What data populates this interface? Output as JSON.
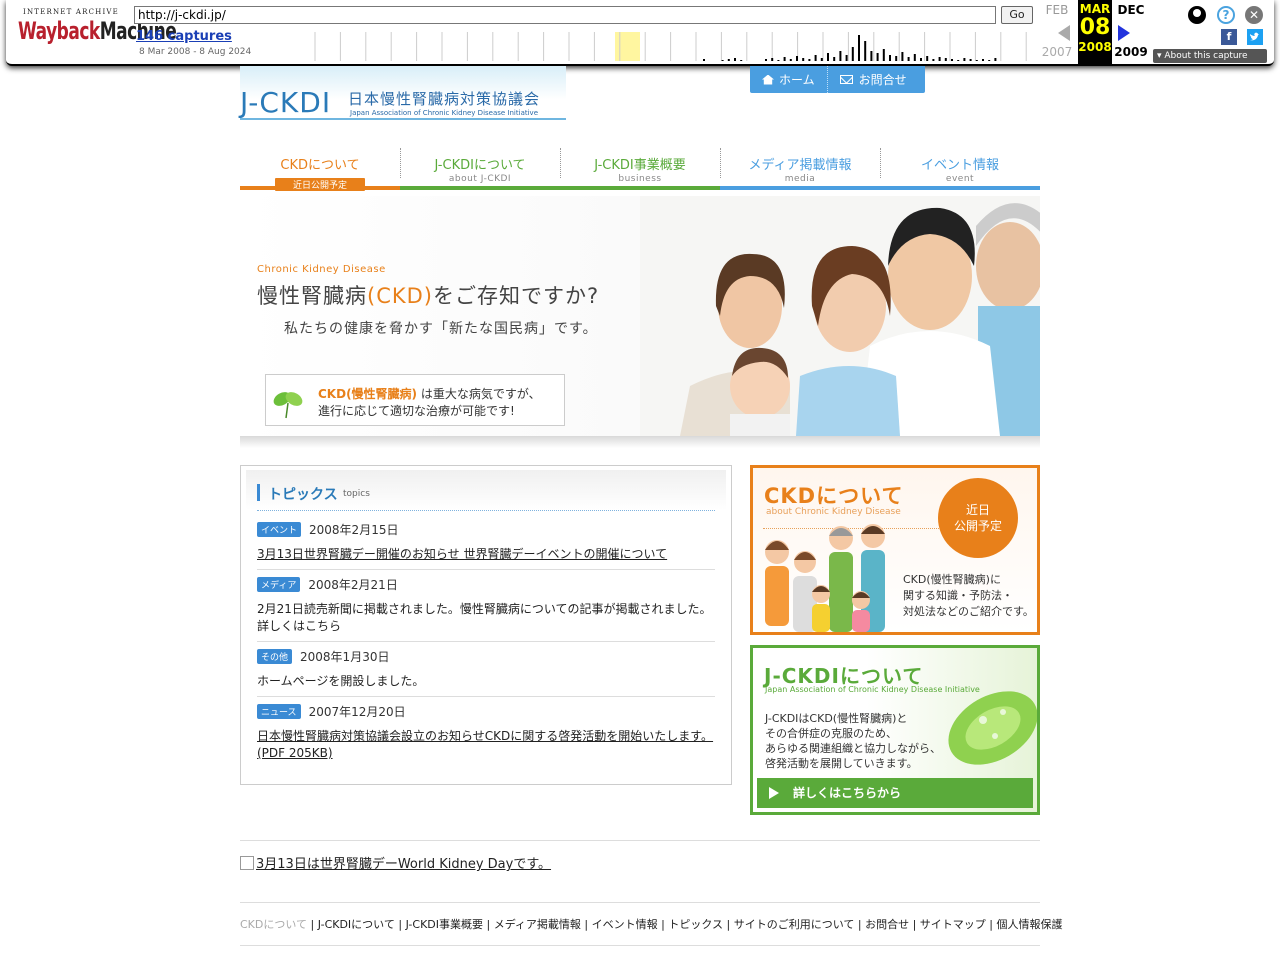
{
  "wayback": {
    "logo_top": "INTERNET ARCHIVE",
    "logo_main_red": "Wayback",
    "logo_main_dark": "Machine",
    "url": "http://j-ckdi.jp/",
    "go_label": "Go",
    "captures": "146 captures",
    "range": "8 Mar 2008 - 8 Aug 2024",
    "prev_month": "FEB",
    "cur_month": "MAR",
    "next_month": "DEC",
    "day": "08",
    "prev_year": "2007",
    "cur_year": "2008",
    "next_year": "2009",
    "about": "About this capture",
    "fb": "f",
    "close": "✕",
    "help": "?"
  },
  "site": {
    "logo_big": "J-CKDI",
    "logo_jp": "日本慢性腎臓病対策協議会",
    "logo_en": "Japan Association of Chronic Kidney Disease Initiative",
    "top_nav": [
      "ホーム",
      "お問合せ"
    ],
    "nav": [
      {
        "title": "CKDについて",
        "sub": "近日公開予定",
        "color": "#e8801a",
        "badge": true
      },
      {
        "title": "J-CKDIについて",
        "sub": "about J-CKDI",
        "color": "#5aaa3a"
      },
      {
        "title": "J-CKDI事業概要",
        "sub": "business",
        "color": "#5aaa3a"
      },
      {
        "title": "メディア掲載情報",
        "sub": "media",
        "color": "#4a9ee0"
      },
      {
        "title": "イベント情報",
        "sub": "event",
        "color": "#4a9ee0"
      }
    ],
    "hero": {
      "sub": "Chronic Kidney Disease",
      "head_pre": "慢性腎臓病",
      "head_ckd": "(CKD)",
      "head_post": "をご存知ですか?",
      "tag": "私たちの健康を脅かす「新たな国民病」です。",
      "note_ckd": "CKD(慢性腎臓病)",
      "note_l1_rest": "は重大な病気ですが、",
      "note_l2": "進行に応じて適切な治療が可能です!"
    },
    "topics": {
      "title": "トピックス",
      "en": "topics",
      "items": [
        {
          "cat": "イベント",
          "date": "2008年2月15日",
          "text": "3月13日世界腎臓デー開催のお知らせ 世界腎臓デーイベントの開催について",
          "link": true
        },
        {
          "cat": "メディア",
          "date": "2008年2月21日",
          "text": "2月21日読売新聞に掲載されました。慢性腎臓病についての記事が掲載されました。詳しくはこちら",
          "link": false
        },
        {
          "cat": "その他",
          "date": "2008年1月30日",
          "text": "ホームページを開設しました。",
          "link": false
        },
        {
          "cat": "ニュース",
          "date": "2007年12月20日",
          "text": "日本慢性腎臓病対策協議会設立のお知らせCKDに関する啓発活動を開始いたします。(PDF 205KB)",
          "link": true
        }
      ]
    },
    "banner_ckd": {
      "title": "CKDについて",
      "en": "about Chronic Kidney Disease",
      "circle_l1": "近日",
      "circle_l2": "公開予定",
      "desc_l1": "CKD(慢性腎臓病)に",
      "desc_l2": "関する知識・予防法・",
      "desc_l3": "対処法などのご紹介です。"
    },
    "banner_jckdi": {
      "title": "J-CKDIについて",
      "en": "Japan Association of Chronic Kidney Disease Initiative",
      "desc_l1": "J-CKDIはCKD(慢性腎臓病)と",
      "desc_l2": "その合併症の克服のため、",
      "desc_l3": "あらゆる関連組織と協力しながら、",
      "desc_l4": "啓発活動を展開していきます。",
      "more": "詳しくはこちらから"
    },
    "wkd_link": "3月13日は世界腎臓デーWorld Kidney Dayです。",
    "footer": {
      "first": "CKDについて",
      "links": [
        "J-CKDIについて",
        "J-CKDI事業概要",
        "メディア掲載情報",
        "イベント情報",
        "トピックス",
        "サイトのご利用について",
        "お問合せ",
        "サイトマップ",
        "個人情報保護"
      ]
    }
  }
}
